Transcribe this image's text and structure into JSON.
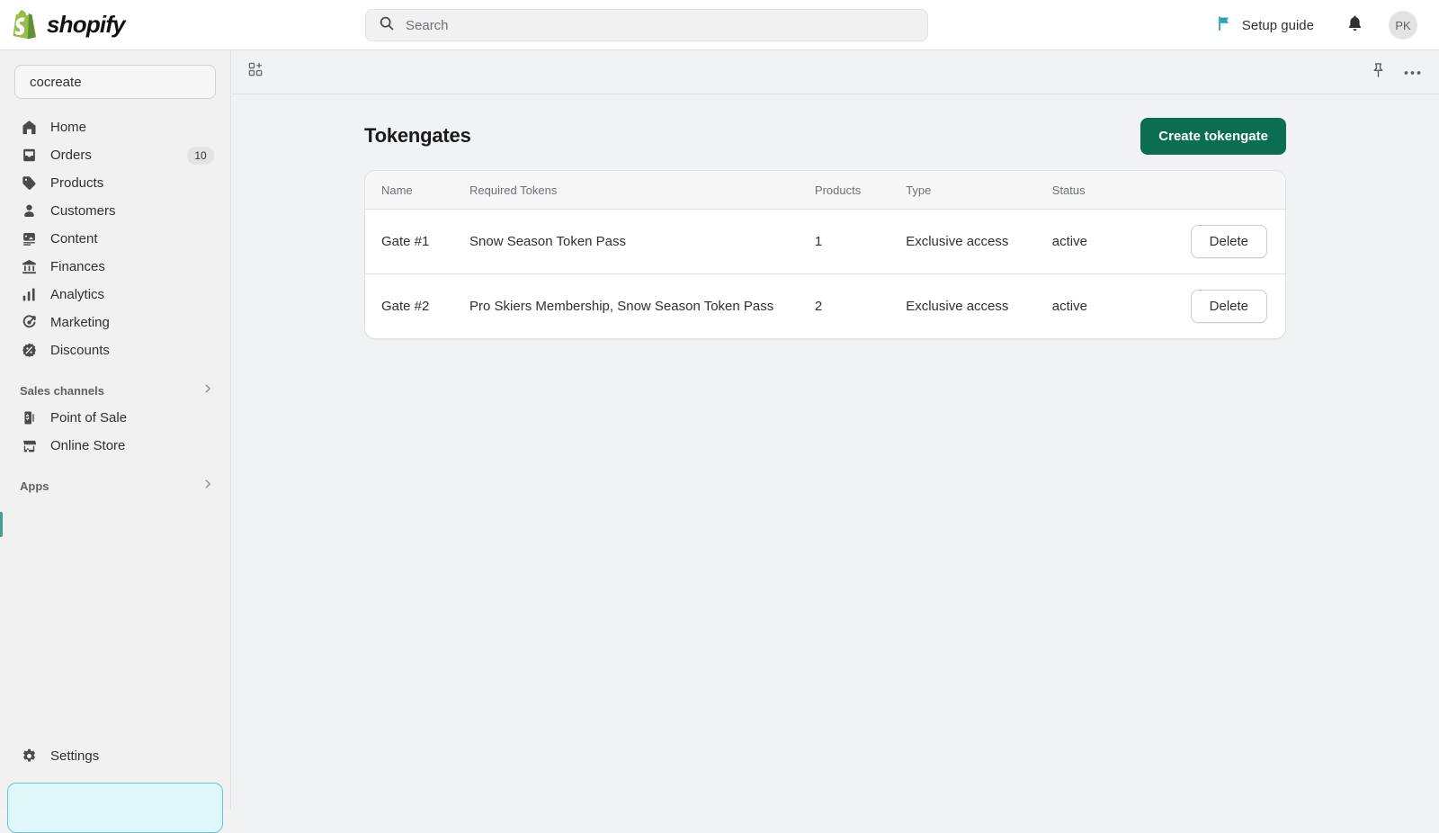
{
  "topbar": {
    "logo_text": "shopify",
    "logo_icon": "shopify-bag-icon",
    "search": {
      "placeholder": "Search",
      "value": "",
      "icon": "search-icon"
    },
    "setup_guide": {
      "label": "Setup guide",
      "icon": "flag-icon",
      "color": "#2aa3b5"
    },
    "notifications_icon": "bell-icon",
    "avatar": {
      "initials": "PK"
    }
  },
  "sidebar": {
    "store": {
      "name": "cocreate"
    },
    "items": [
      {
        "label": "Home",
        "icon": "home-icon"
      },
      {
        "label": "Orders",
        "icon": "orders-inbox-icon",
        "badge": "10"
      },
      {
        "label": "Products",
        "icon": "tag-icon"
      },
      {
        "label": "Customers",
        "icon": "person-icon"
      },
      {
        "label": "Content",
        "icon": "content-image-icon"
      },
      {
        "label": "Finances",
        "icon": "bank-icon"
      },
      {
        "label": "Analytics",
        "icon": "bar-chart-icon"
      },
      {
        "label": "Marketing",
        "icon": "megaphone-target-icon"
      },
      {
        "label": "Discounts",
        "icon": "discount-percent-icon"
      }
    ],
    "sections": [
      {
        "title": "Sales channels",
        "chevron": "chevron-right-icon",
        "items": [
          {
            "label": "Point of Sale",
            "icon": "point-of-sale-icon"
          },
          {
            "label": "Online Store",
            "icon": "storefront-icon"
          }
        ]
      },
      {
        "title": "Apps",
        "chevron": "chevron-right-icon",
        "items": []
      }
    ],
    "settings": {
      "label": "Settings",
      "icon": "gear-icon"
    }
  },
  "app_header": {
    "apps_icon": "grid-plus-icon",
    "pin_icon": "pin-icon",
    "more_icon": "ellipsis-horizontal-icon"
  },
  "main": {
    "title": "Tokengates",
    "create_button": "Create tokengate",
    "table": {
      "columns": [
        "Name",
        "Required Tokens",
        "Products",
        "Type",
        "Status",
        ""
      ],
      "rows": [
        {
          "name": "Gate #1",
          "tokens": "Snow Season Token Pass",
          "products": "1",
          "type": "Exclusive access",
          "status": "active",
          "action": "Delete"
        },
        {
          "name": "Gate #2",
          "tokens": "Pro Skiers Membership, Snow Season Token Pass",
          "products": "2",
          "type": "Exclusive access",
          "status": "active",
          "action": "Delete"
        }
      ]
    }
  },
  "colors": {
    "brand_green": "#0b6e50",
    "logo_green": "#95bf47",
    "accent_teal": "#4a9e8f",
    "page_bg": "#f1f2f4"
  }
}
